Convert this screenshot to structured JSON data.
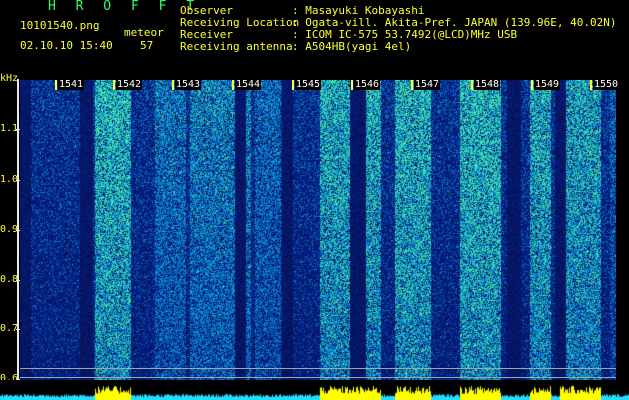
{
  "header": {
    "brand": "H R O F F T",
    "filename": "10101540.png",
    "timestamp": "02.10.10 15:40",
    "meteor_label": "meteor",
    "meteor_count": "57"
  },
  "info": [
    {
      "key": "Observer",
      "value": ": Masayuki Kobayashi"
    },
    {
      "key": "Receiving Location",
      "value": ": Ogata-vill. Akita-Pref. JAPAN (139.96E, 40.02N)"
    },
    {
      "key": "Receiver",
      "value": ": ICOM IC-575 53.7492(@LCD)MHz USB"
    },
    {
      "key": "Receiving antenna",
      "value": ": A504HB(yagi 4el)"
    }
  ],
  "axis": {
    "unit": "kHz",
    "ticks": [
      "1.1",
      "1.0",
      "0.9",
      "0.8",
      "0.7",
      "0.6"
    ],
    "tick_values": [
      1.1,
      1.0,
      0.9,
      0.8,
      0.7,
      0.6
    ]
  },
  "minutes": [
    "1541",
    "1542",
    "1543",
    "1544",
    "1545",
    "1546",
    "1547",
    "1548",
    "1549",
    "1550"
  ],
  "colors": {
    "text_yellow": "#ffff33",
    "brand_green": "#33ff66",
    "spectrogram_base": "#0a1a8c",
    "spectrogram_hot": "#2ee6b0",
    "bottom_bar": "#ccff00"
  }
}
